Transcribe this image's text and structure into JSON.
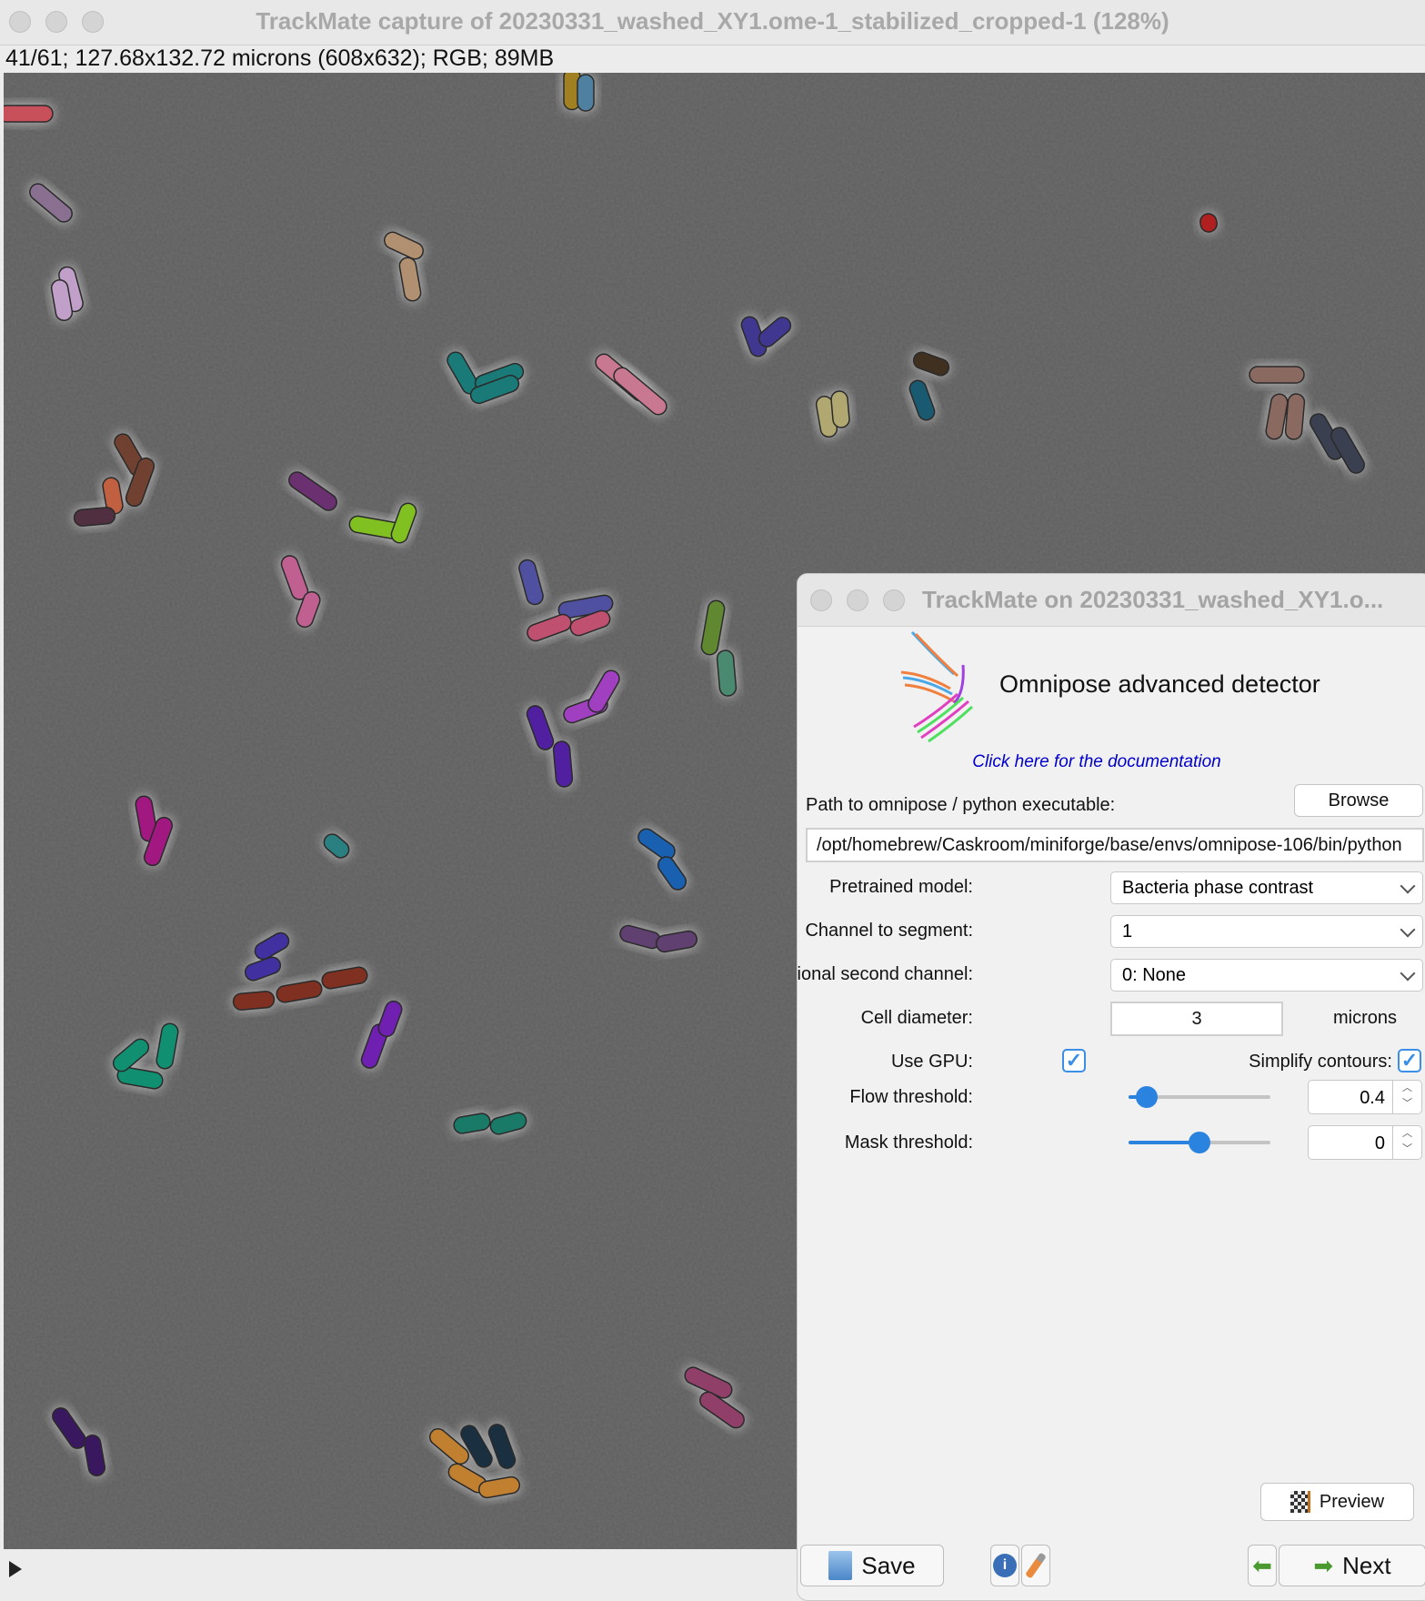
{
  "window": {
    "title": "TrackMate capture of 20230331_washed_XY1.ome-1_stabilized_cropped-1 (128%)",
    "info": "41/61; 127.68x132.72 microns (608x632); RGB; 89MB"
  },
  "dialog": {
    "title": "TrackMate on 20230331_washed_XY1.o...",
    "heading": "Omnipose advanced detector",
    "doc_link": "Click here for the documentation",
    "path_label": "Path to omnipose / python executable:",
    "browse_label": "Browse",
    "path_value": "/opt/homebrew/Caskroom/miniforge/base/envs/omnipose-106/bin/python",
    "pretrained_label": "Pretrained model:",
    "pretrained_value": "Bacteria phase contrast",
    "channel_label": "Channel to segment:",
    "channel_value": "1",
    "second_channel_label": "Optional second channel:",
    "second_channel_value": "0: None",
    "diameter_label": "Cell diameter:",
    "diameter_value": "3",
    "diameter_unit": "microns",
    "gpu_label": "Use GPU:",
    "gpu_checked": true,
    "simplify_label": "Simplify contours:",
    "simplify_checked": true,
    "flow_label": "Flow threshold:",
    "flow_value": "0.4",
    "flow_slider_fraction": 0.13,
    "mask_label": "Mask threshold:",
    "mask_value": "0",
    "mask_slider_fraction": 0.5,
    "preview_label": "Preview",
    "save_label": "Save",
    "next_label": "Next"
  },
  "colors": {
    "accent": "#2b83e0",
    "link": "#0000cc"
  }
}
